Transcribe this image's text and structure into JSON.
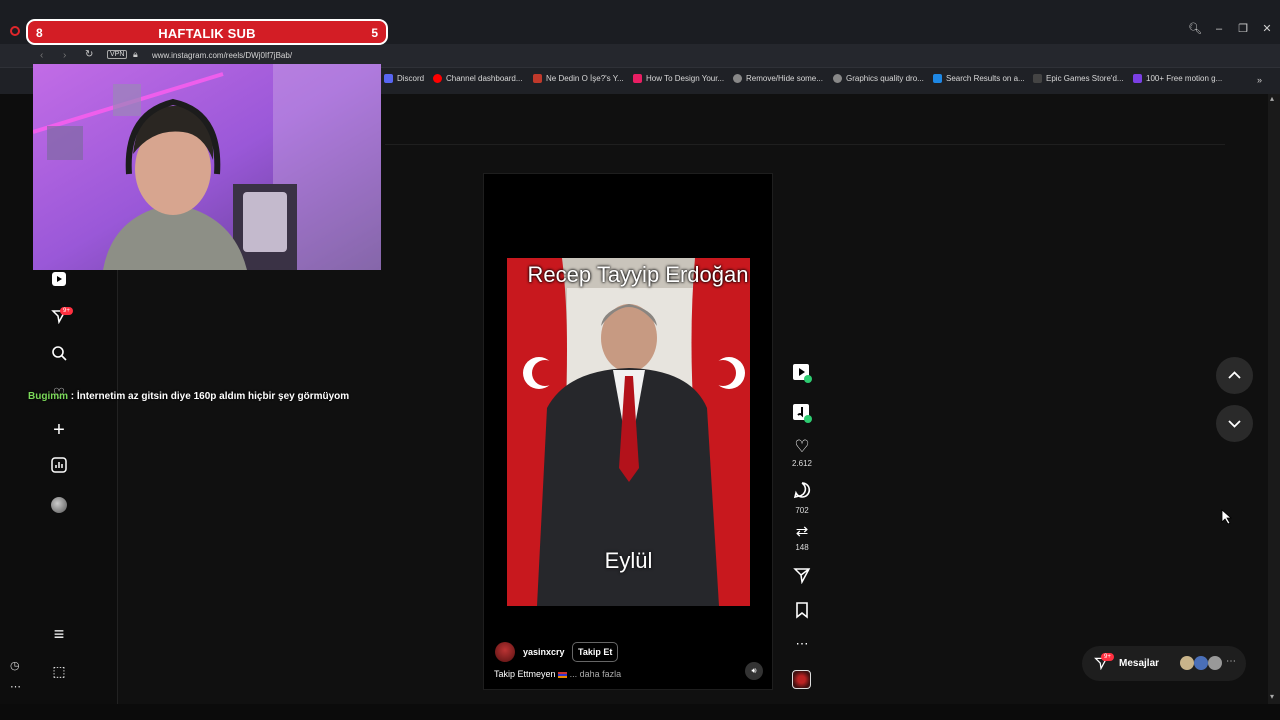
{
  "browser": {
    "url": "www.instagram.com/reels/DWj0If7jBab/",
    "vpn_label": "VPN",
    "ai_label": "AI",
    "bookmarks": [
      {
        "label": "Discord",
        "color": "#5865f2"
      },
      {
        "label": "Channel dashboard...",
        "color": "#ff0000"
      },
      {
        "label": "Ne Dedin O İşe?'s Y...",
        "color": "#c0392b"
      },
      {
        "label": "How To Design Your...",
        "color": "#e91e63"
      },
      {
        "label": "Remove/Hide some...",
        "color": "#888888"
      },
      {
        "label": "Graphics quality dro...",
        "color": "#888888"
      },
      {
        "label": "Search Results on a...",
        "color": "#1e88e5"
      },
      {
        "label": "Epic Games Store'd...",
        "color": "#444444"
      },
      {
        "label": "100+ Free motion g...",
        "color": "#7b3fe4"
      }
    ]
  },
  "overlay": {
    "sub_label": "HAFTALIK SUB",
    "left_count": "8",
    "right_count": "5",
    "chat_user": "Bugimm",
    "chat_message": " : İnternetim az gitsin diye 160p aldım hiçbir şey görmüyom"
  },
  "sidebar": {
    "notification_badge": "9+"
  },
  "reel": {
    "title": "Recep Tayyip Erdoğan",
    "subtitle": "Eylül",
    "username": "yasinxcry",
    "follow_label": "Takip Et",
    "caption_prefix": "Takip Ettmeyen",
    "caption_more": "... daha fazla",
    "likes": "2.612",
    "comments": "702",
    "reposts": "148"
  },
  "messages": {
    "label": "Mesajlar",
    "badge": "9+"
  },
  "colors": {
    "accent_red": "#d31d25",
    "badge_red": "#ff3040",
    "chat_user_green": "#7bd95a"
  }
}
